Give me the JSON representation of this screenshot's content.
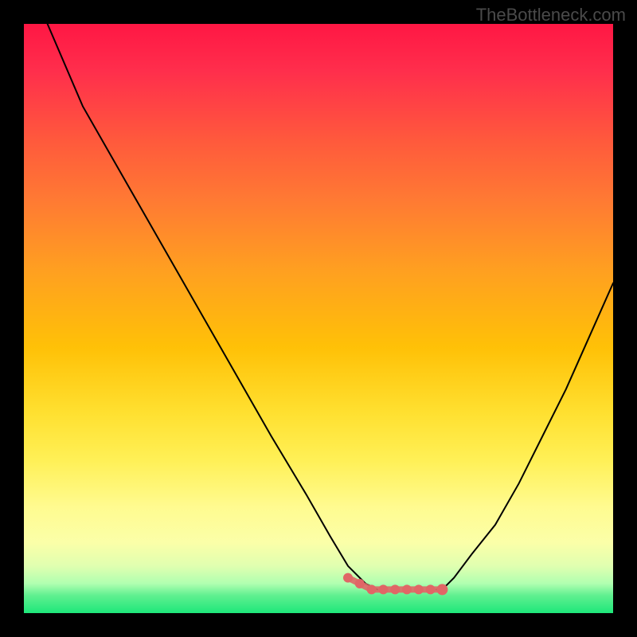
{
  "watermark": "TheBottleneck.com",
  "chart_data": {
    "type": "line",
    "title": "",
    "xlabel": "",
    "ylabel": "",
    "xlim": [
      0,
      100
    ],
    "ylim": [
      0,
      100
    ],
    "description": "Bottleneck curve plot: background gradient encodes bottleneck severity (red=high near top, green=low near bottom). Two black curves descend from top toward a shared minimum region near x≈58–68 at y≈4–6, forming a V/U shape. A cluster of salmon dots and short salmon segments marks the minimum trough.",
    "series": [
      {
        "name": "left-curve",
        "x": [
          4,
          10,
          18,
          26,
          34,
          42,
          48,
          52,
          55,
          58,
          60
        ],
        "y": [
          100,
          86,
          72,
          58,
          44,
          30,
          20,
          13,
          8,
          5,
          4
        ]
      },
      {
        "name": "right-curve",
        "x": [
          100,
          96,
          92,
          88,
          84,
          80,
          76,
          73,
          71,
          70
        ],
        "y": [
          56,
          47,
          38,
          30,
          22,
          15,
          10,
          6,
          4,
          4
        ]
      },
      {
        "name": "trough-markers",
        "x": [
          55,
          57,
          59,
          61,
          63,
          65,
          67,
          69,
          71
        ],
        "y": [
          6,
          5,
          4,
          4,
          4,
          4,
          4,
          4,
          4
        ]
      }
    ],
    "gradient_stops": [
      {
        "pct": 0,
        "color": "#ff1744"
      },
      {
        "pct": 8,
        "color": "#ff2e4c"
      },
      {
        "pct": 20,
        "color": "#ff5a3c"
      },
      {
        "pct": 30,
        "color": "#ff7a33"
      },
      {
        "pct": 42,
        "color": "#ffa020"
      },
      {
        "pct": 55,
        "color": "#ffc107"
      },
      {
        "pct": 66,
        "color": "#ffe030"
      },
      {
        "pct": 74,
        "color": "#fff056"
      },
      {
        "pct": 82,
        "color": "#fffb90"
      },
      {
        "pct": 88,
        "color": "#fbffa8"
      },
      {
        "pct": 92,
        "color": "#e0ffb0"
      },
      {
        "pct": 95,
        "color": "#b0ffb0"
      },
      {
        "pct": 97,
        "color": "#60f090"
      },
      {
        "pct": 100,
        "color": "#1de77a"
      }
    ],
    "marker_color": "#e06666"
  }
}
